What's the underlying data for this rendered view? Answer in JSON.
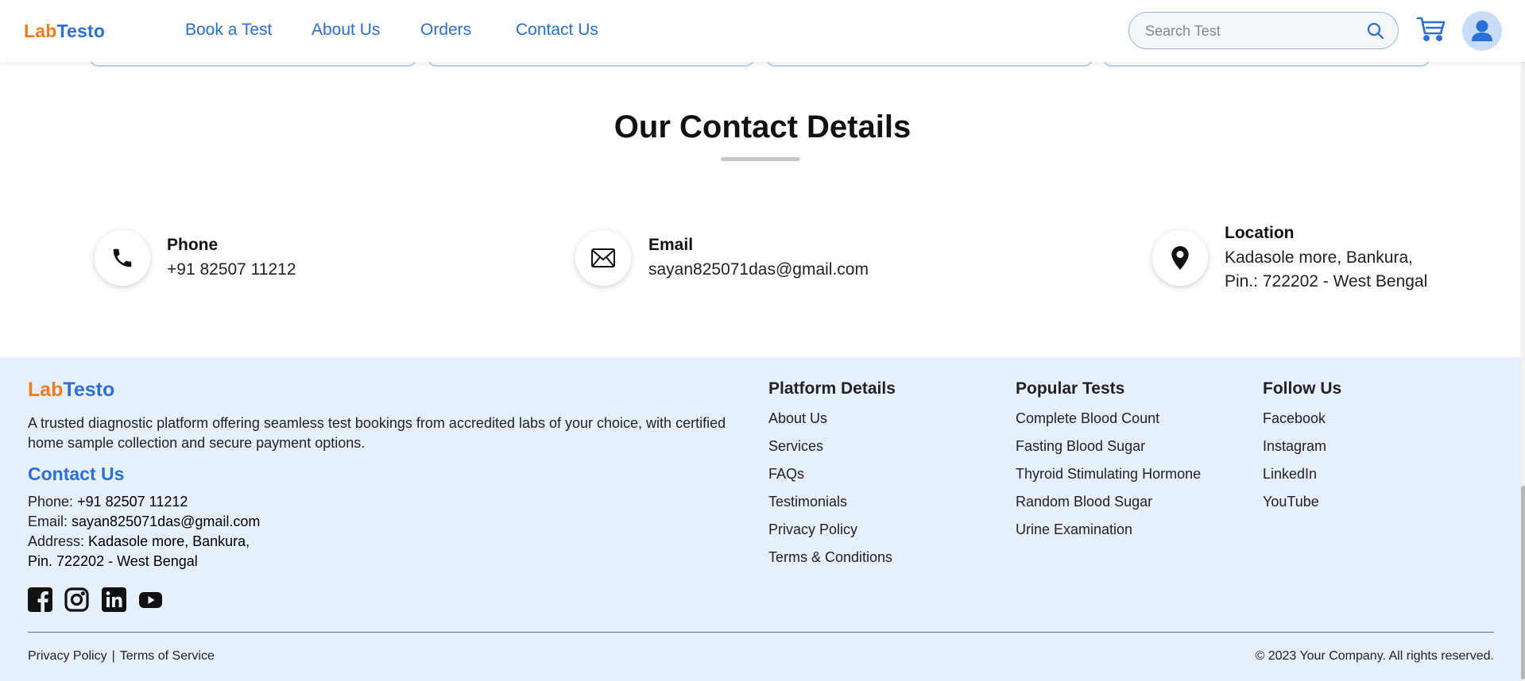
{
  "header": {
    "logo": {
      "lab": "Lab",
      "testo": "Testo"
    },
    "nav": [
      "Book a Test",
      "About Us",
      "Orders",
      "Contact Us"
    ],
    "search": {
      "placeholder": "Search Test",
      "icon": "search-icon"
    },
    "cart_icon": "cart-icon",
    "avatar_icon": "user-avatar-icon",
    "colors": {
      "brand_orange": "#f07a1c",
      "brand_blue": "#2a6fd6"
    }
  },
  "contact": {
    "title": "Our Contact Details",
    "phone": {
      "label": "Phone",
      "value": "+91 82507 11212",
      "icon": "phone-icon"
    },
    "email": {
      "label": "Email",
      "value": "sayan825071das@gmail.com",
      "icon": "envelope-icon"
    },
    "location": {
      "label": "Location",
      "line1": "Kadasole more, Bankura,",
      "line2": "Pin.: 722202 - West Bengal",
      "icon": "map-pin-icon"
    }
  },
  "footer": {
    "logo": {
      "lab": "Lab",
      "testo": "Testo"
    },
    "description": "A trusted diagnostic platform offering seamless test bookings from accredited labs of your choice, with certified home sample collection and secure payment options.",
    "contact_heading": "Contact Us",
    "phone_label": "Phone: ",
    "phone_value": "+91 82507 11212",
    "email_label": "Email: ",
    "email_value": "sayan825071das@gmail.com",
    "address_label": "Address: ",
    "address_line1": "Kadasole more, Bankura,",
    "address_line2": "Pin. 722202 - West Bengal",
    "social_icons": [
      "facebook-icon",
      "instagram-icon",
      "linkedin-icon",
      "youtube-icon"
    ],
    "platform": {
      "heading": "Platform Details",
      "items": [
        "About Us",
        "Services",
        "FAQs",
        "Testimonials",
        "Privacy Policy",
        "Terms & Conditions"
      ]
    },
    "popular": {
      "heading": "Popular Tests",
      "items": [
        "Complete Blood Count",
        "Fasting Blood Sugar",
        "Thyroid Stimulating Hormone",
        "Random Blood Sugar",
        "Urine Examination"
      ]
    },
    "follow": {
      "heading": "Follow Us",
      "items": [
        "Facebook",
        "Instagram",
        "LinkedIn",
        "YouTube"
      ]
    },
    "bottom": {
      "privacy": "Privacy Policy",
      "separator": "|",
      "terms": "Terms of Service",
      "copyright": "© 2023 Your Company. All rights reserved."
    },
    "background": "#e6f0fc"
  }
}
